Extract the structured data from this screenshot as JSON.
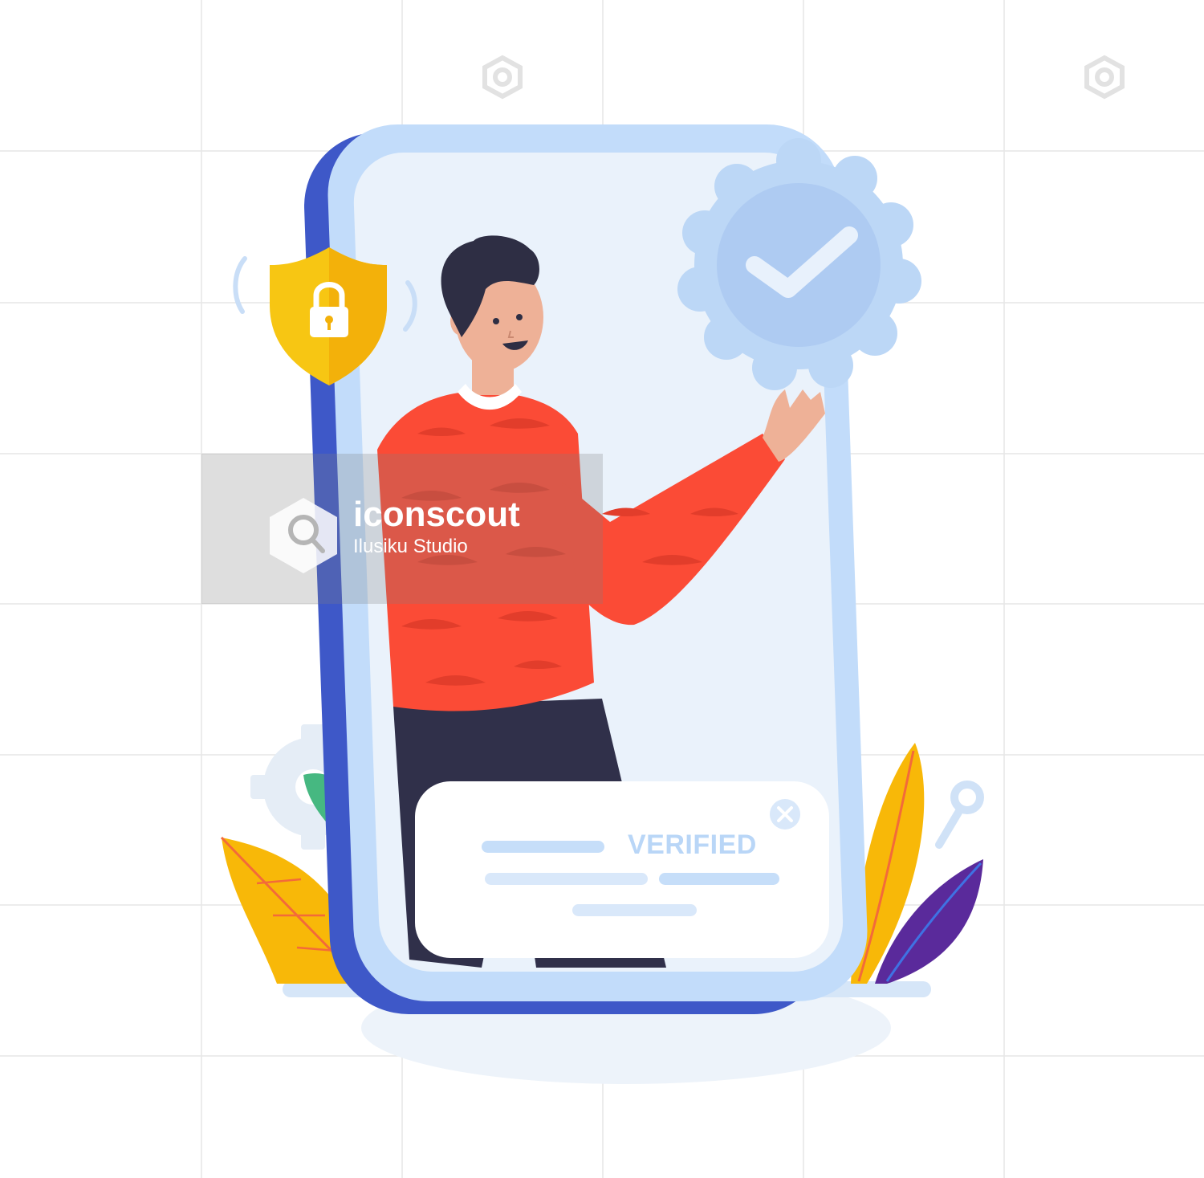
{
  "notification": {
    "status_text": "VERIFIED"
  },
  "watermark": {
    "brand": "iconscout",
    "studio": "Ilusiku Studio"
  },
  "colors": {
    "phone_back": "#3e58c8",
    "phone_frame": "#c2dcfa",
    "screen": "#eaf2fb",
    "badge": "#bcd7f6",
    "shield": "#f7c613",
    "sweater": "#fb4b36",
    "hair": "#2e2e44",
    "pants": "#30304a",
    "leaf_yellow": "#f8b808",
    "leaf_purple": "#5a2a9b",
    "leaf_green": "#46b881"
  },
  "icons": [
    "shield-lock-icon",
    "verified-badge-icon",
    "close-icon",
    "gear-icon",
    "key-icon"
  ]
}
